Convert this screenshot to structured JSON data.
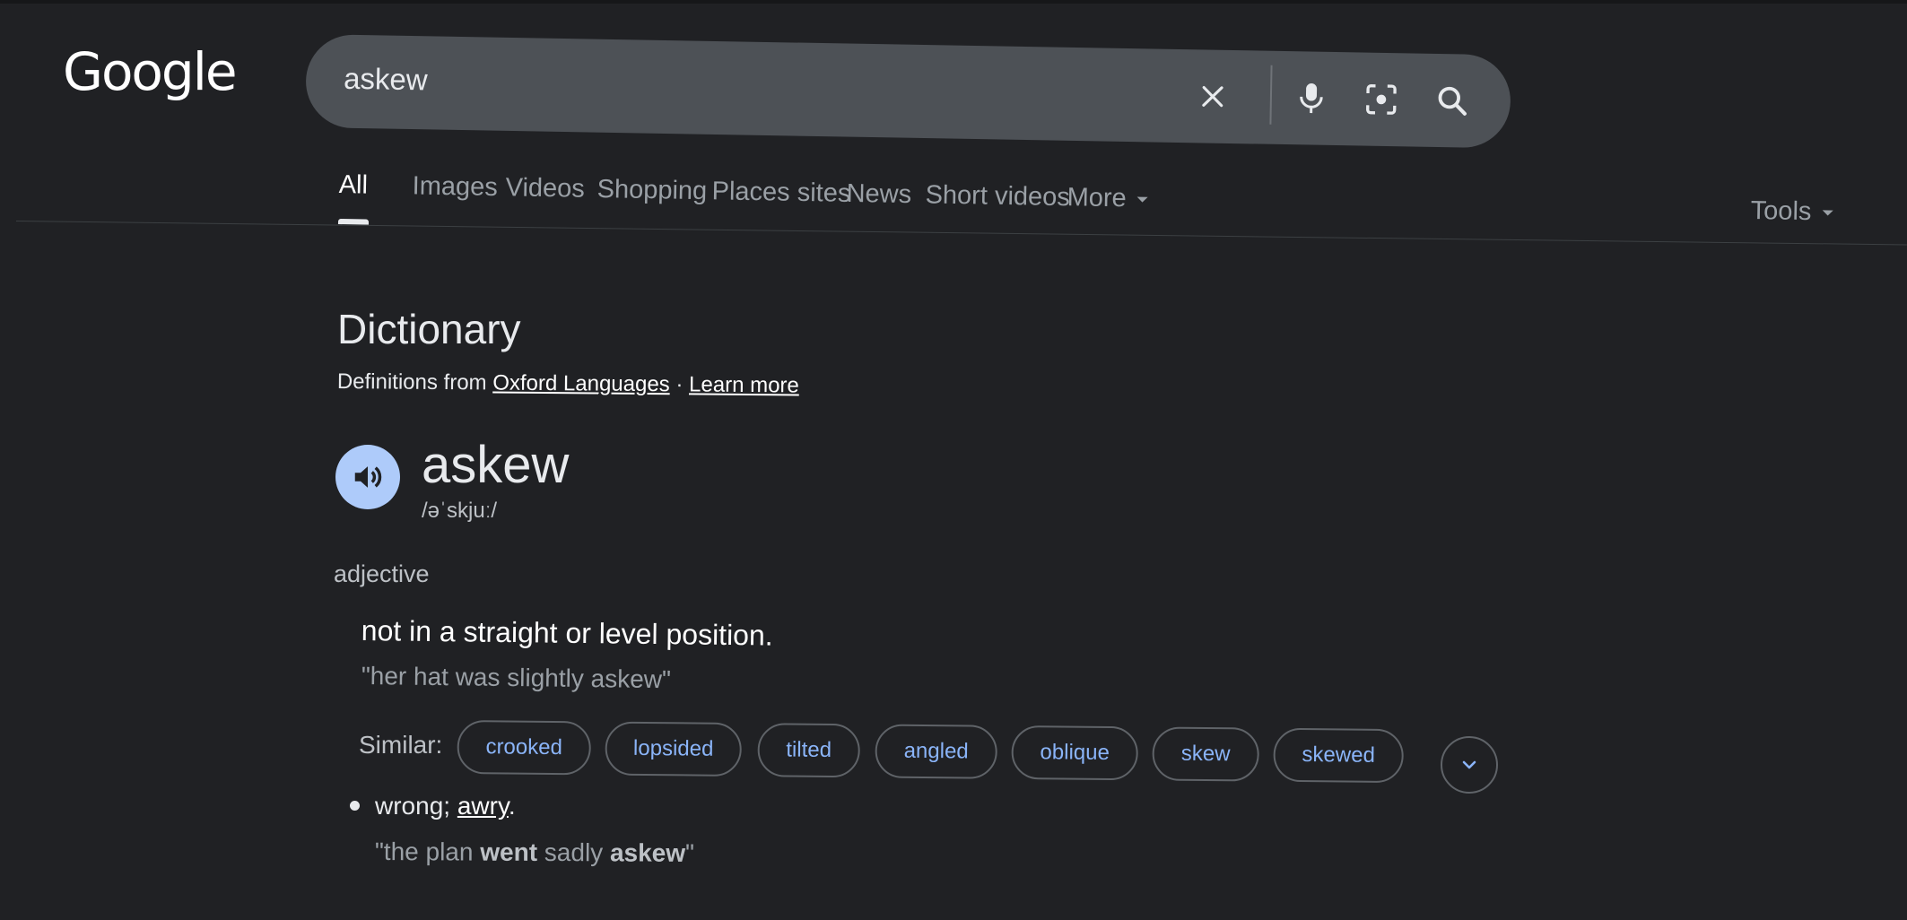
{
  "logo": {
    "text": "Google"
  },
  "search": {
    "query": "askew"
  },
  "icons": {
    "clear": "close-icon",
    "voice": "microphone-icon",
    "lens": "camera-lens-icon",
    "search": "search-icon",
    "speaker": "speaker-icon",
    "expand": "chevron-down-icon"
  },
  "tabs": [
    {
      "label": "All",
      "active": true
    },
    {
      "label": "Images"
    },
    {
      "label": "Videos"
    },
    {
      "label": "Shopping"
    },
    {
      "label": "Places sites"
    },
    {
      "label": "News"
    },
    {
      "label": "Short videos"
    },
    {
      "label": "More"
    }
  ],
  "tools_label": "Tools",
  "dictionary": {
    "title": "Dictionary",
    "source_prefix": "Definitions from",
    "source_link": "Oxford Languages",
    "separator": "·",
    "learn_more": "Learn more",
    "word": "askew",
    "phonetic": "/əˈskjuː/",
    "part_of_speech": "adjective",
    "definition": "not in a straight or level position.",
    "example": "\"her hat was slightly askew\"",
    "similar_label": "Similar:",
    "similar": [
      "crooked",
      "lopsided",
      "tilted",
      "angled",
      "oblique",
      "skew",
      "skewed"
    ],
    "sub_definition": {
      "text": "wrong;",
      "link": "awry",
      "punct": ".",
      "example_open": "\"the plan",
      "example_bold1": "went",
      "example_mid": "sadly",
      "example_bold2": "askew",
      "example_close": "\""
    }
  },
  "colors": {
    "background": "#202124",
    "searchbox": "#4d5156",
    "chip_text": "#8ab4f8",
    "speaker_bg": "#aecbfa"
  }
}
